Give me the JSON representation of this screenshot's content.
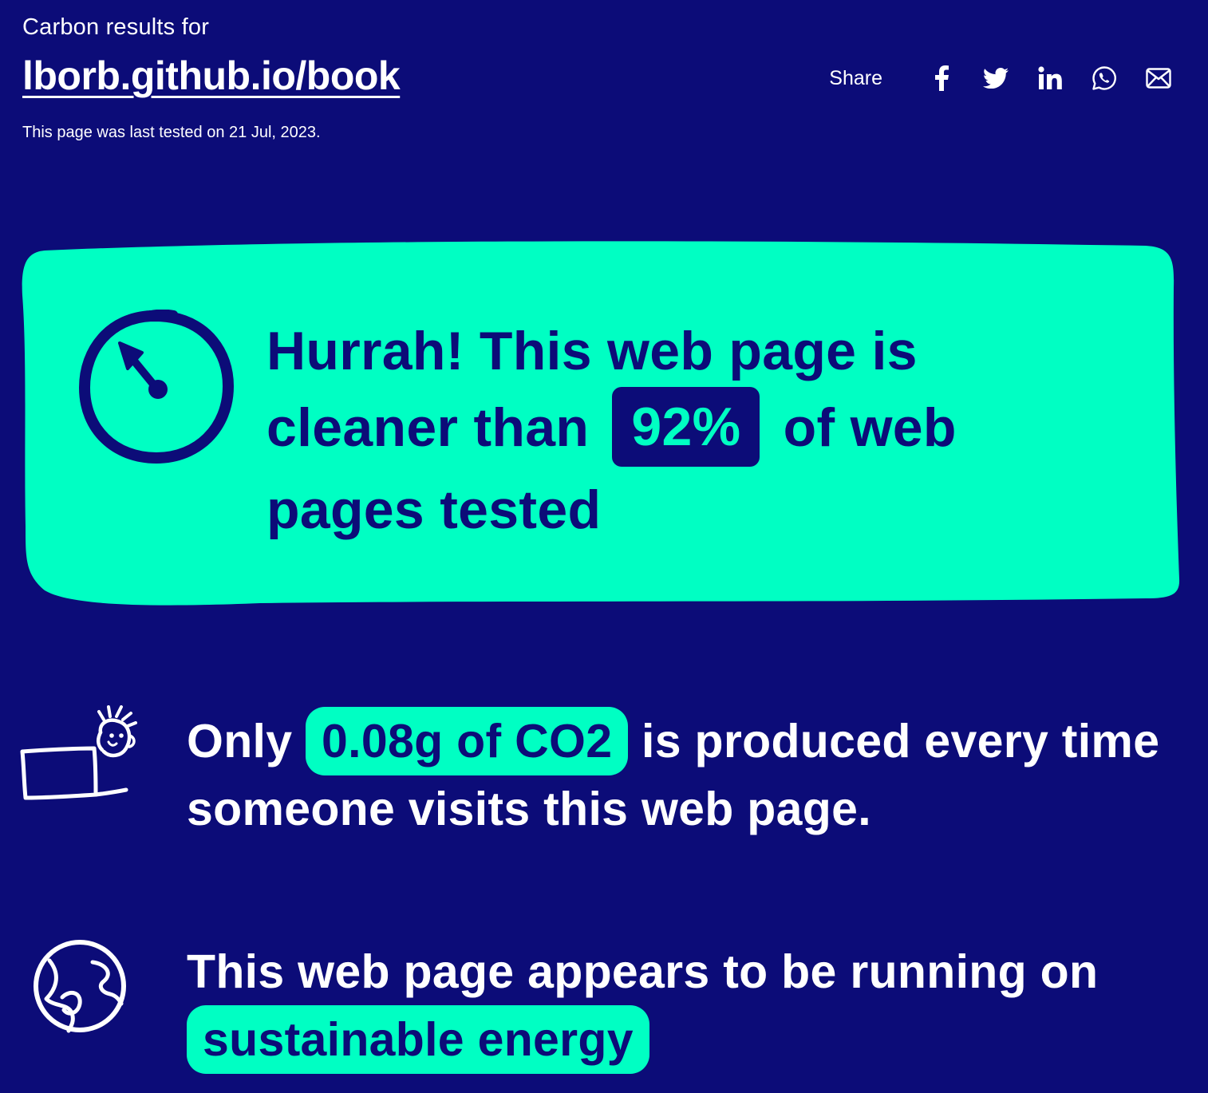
{
  "header": {
    "label": "Carbon results for",
    "site_url": "lborb.github.io/book",
    "tested_text": "This page was last tested on 21 Jul, 2023."
  },
  "share": {
    "label": "Share",
    "icons": [
      "facebook-icon",
      "twitter-icon",
      "linkedin-icon",
      "whatsapp-icon",
      "email-icon"
    ]
  },
  "score": {
    "line_1": "Hurrah! This web page is",
    "line_2_before": "cleaner than",
    "percent": "92%",
    "line_2_after": "of web",
    "line_3": "pages tested",
    "icon": "gauge-icon"
  },
  "co2": {
    "prefix": "Only",
    "amount": "0.08g of CO2",
    "suffix": "is produced every time someone visits this web page.",
    "icon": "person-laptop-icon"
  },
  "energy": {
    "text": "This web page appears to be running on",
    "highlight": "sustainable energy",
    "icon": "globe-icon"
  },
  "colors": {
    "background": "#0c0c78",
    "accent": "#00ffc3",
    "text": "#ffffff"
  }
}
